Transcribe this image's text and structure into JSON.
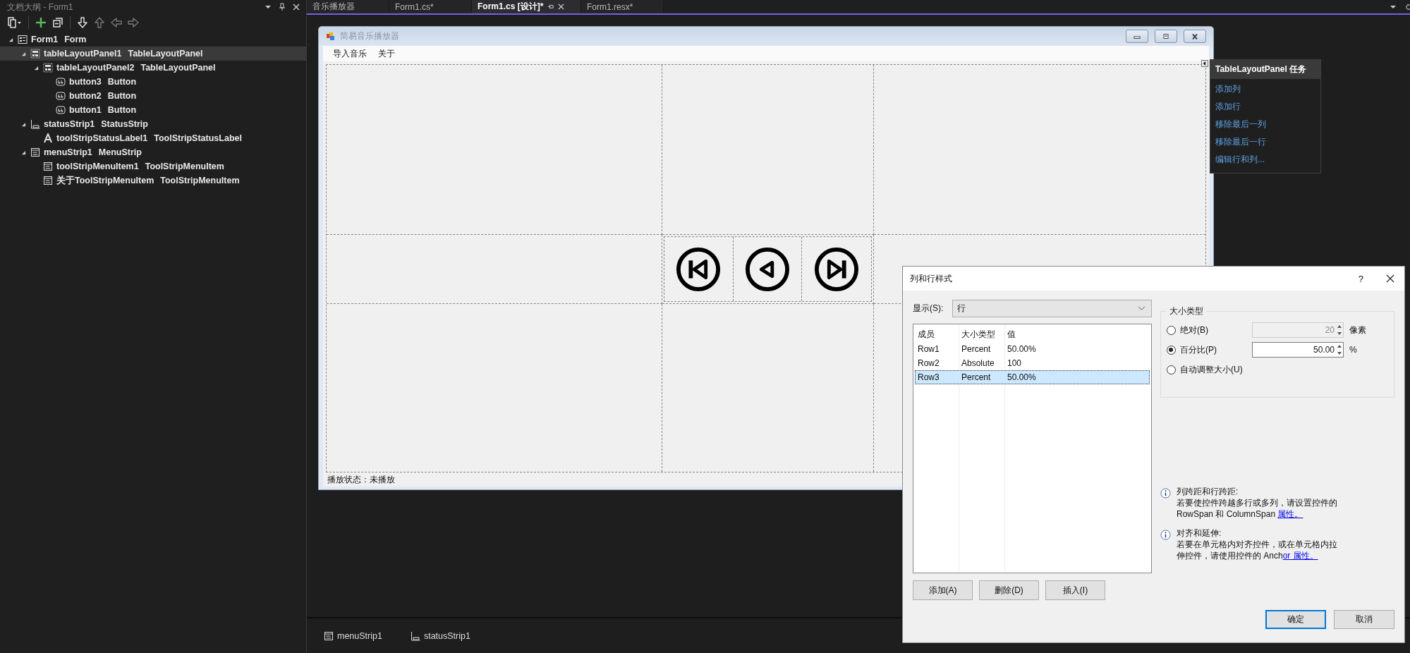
{
  "outline_panel": {
    "title": "文档大纲 - Form1",
    "toolbar": [
      {
        "kind": "copy",
        "disabled": false
      },
      {
        "kind": "add",
        "disabled": false
      },
      {
        "kind": "collapse",
        "disabled": false
      },
      {
        "kind": "down",
        "disabled": false
      },
      {
        "kind": "up",
        "disabled": true
      },
      {
        "kind": "left",
        "disabled": true
      },
      {
        "kind": "right",
        "disabled": true
      }
    ],
    "tree": [
      {
        "name": "Form1",
        "type": "Form",
        "kind": "form",
        "selected": false,
        "expanded": true,
        "children": [
          {
            "name": "tableLayoutPanel1",
            "type": "TableLayoutPanel",
            "kind": "table-panel",
            "selected": true,
            "expanded": true,
            "children": [
              {
                "name": "tableLayoutPanel2",
                "type": "TableLayoutPanel",
                "kind": "table-panel",
                "selected": false,
                "expanded": true,
                "children": [
                  {
                    "name": "button3",
                    "type": "Button",
                    "kind": "button",
                    "selected": false
                  },
                  {
                    "name": "button2",
                    "type": "Button",
                    "kind": "button",
                    "selected": false
                  },
                  {
                    "name": "button1",
                    "type": "Button",
                    "kind": "button",
                    "selected": false
                  }
                ]
              }
            ]
          },
          {
            "name": "statusStrip1",
            "type": "StatusStrip",
            "kind": "status-strip",
            "selected": false,
            "expanded": true,
            "children": [
              {
                "name": "toolStripStatusLabel1",
                "type": "ToolStripStatusLabel",
                "kind": "label",
                "selected": false
              }
            ]
          },
          {
            "name": "menuStrip1",
            "type": "MenuStrip",
            "kind": "menu-strip",
            "selected": false,
            "expanded": true,
            "children": [
              {
                "name": "toolStripMenuItem1",
                "type": "ToolStripMenuItem",
                "kind": "menu-item",
                "selected": false
              },
              {
                "name": "关于ToolStripMenuItem",
                "type": "ToolStripMenuItem",
                "kind": "menu-item",
                "selected": false
              }
            ]
          }
        ]
      }
    ]
  },
  "document_tabs": [
    {
      "label": "音乐播放器",
      "selected": false
    },
    {
      "label": "Form1.cs*",
      "selected": false
    },
    {
      "label": "Form1.cs [设计]*",
      "selected": true
    },
    {
      "label": "Form1.resx*",
      "selected": false
    }
  ],
  "form": {
    "title": "简易音乐播放器",
    "menu": [
      "导入音乐",
      "关于"
    ],
    "media_buttons": [
      {
        "kind": "skip-back"
      },
      {
        "kind": "reverse"
      },
      {
        "kind": "skip-forward"
      }
    ],
    "status_label": "播放状态：未播放"
  },
  "task_panel": {
    "title": "TableLayoutPanel 任务",
    "actions": [
      "添加列",
      "添加行",
      "移除最后一列",
      "移除最后一行",
      "编辑行和列..."
    ]
  },
  "dialog": {
    "title": "列和行样式",
    "help": "?",
    "show_label": "显示(S):",
    "show_value": "行",
    "columns": [
      "成员",
      "大小类型",
      "值"
    ],
    "rows": [
      {
        "member": "Row1",
        "size_type": "Percent",
        "value": "50.00%",
        "selected": false
      },
      {
        "member": "Row2",
        "size_type": "Absolute",
        "value": "100",
        "selected": false
      },
      {
        "member": "Row3",
        "size_type": "Percent",
        "value": "50.00%",
        "selected": true
      }
    ],
    "list_buttons": [
      "添加(A)",
      "删除(D)",
      "插入(I)"
    ],
    "size_group": {
      "title": "大小类型",
      "options": [
        {
          "label": "绝对(B)",
          "selected": false,
          "field": "20",
          "unit": "像素",
          "disabled": true
        },
        {
          "label": "百分比(P)",
          "selected": true,
          "field": "50.00",
          "unit": "%",
          "disabled": false
        },
        {
          "label": "自动调整大小(U)",
          "selected": false
        }
      ]
    },
    "notes": [
      {
        "title": "列跨距和行跨距:",
        "body": "若要使控件跨越多行或多列，请设置控件的 RowSpan 和 ColumnSpan ",
        "link": "属性。"
      },
      {
        "title": "对齐和延伸:",
        "body": "若要在单元格内对齐控件，或在单元格内拉伸控件，请使用控件的 Anch",
        "link": "or 属性。"
      }
    ],
    "ok": "确定",
    "cancel": "取消"
  },
  "component_tray": [
    {
      "name": "menuStrip1",
      "kind": "menu-strip"
    },
    {
      "name": "statusStrip1",
      "kind": "status-strip"
    }
  ]
}
